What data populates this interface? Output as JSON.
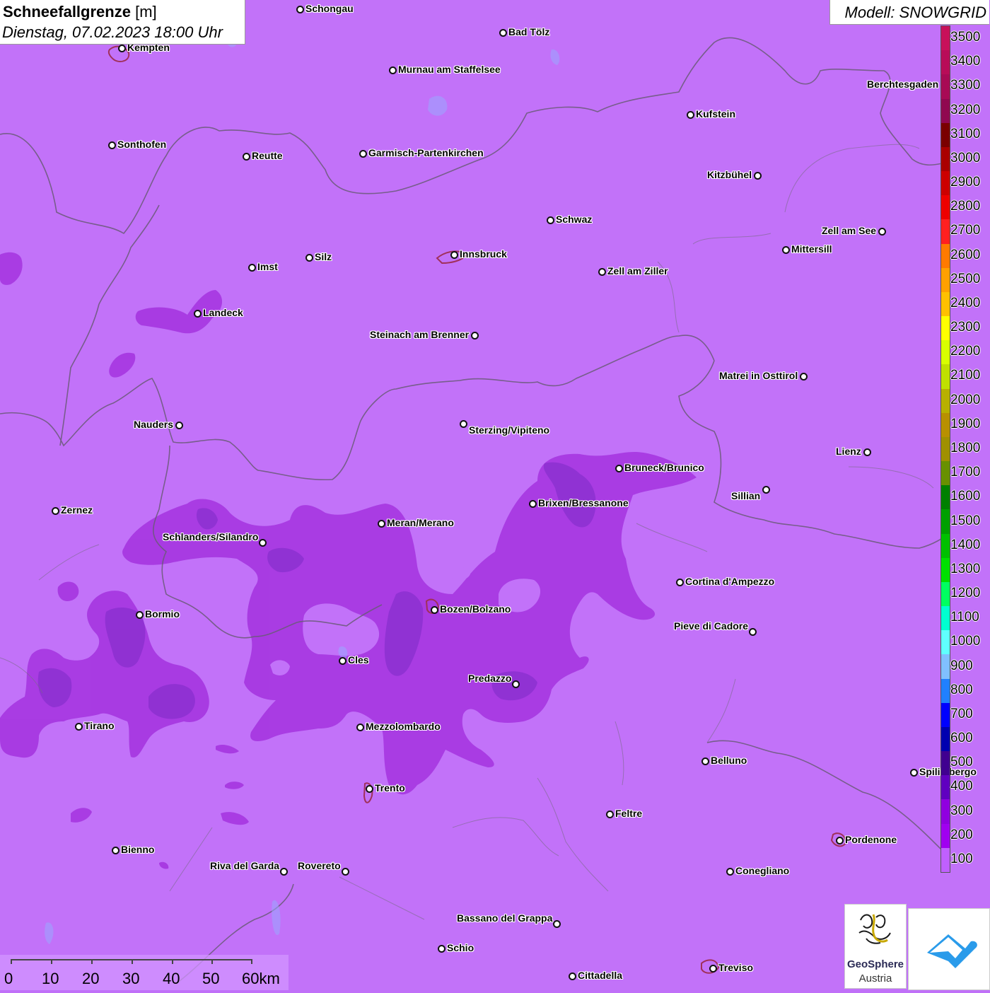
{
  "title": {
    "main": "Schneefallgrenze",
    "unit": "[m]",
    "datetime": "Dienstag, 07.02.2023 18:00 Uhr"
  },
  "model": "Modell: SNOWGRID",
  "legend": {
    "labels": [
      "3500",
      "3400",
      "3300",
      "3200",
      "3100",
      "3000",
      "2900",
      "2800",
      "2700",
      "2600",
      "2500",
      "2400",
      "2300",
      "2200",
      "2100",
      "2000",
      "1900",
      "1800",
      "1700",
      "1600",
      "1500",
      "1400",
      "1300",
      "1200",
      "1100",
      "1000",
      "900",
      "800",
      "700",
      "600",
      "500",
      "400",
      "300",
      "200",
      "100"
    ],
    "colors": [
      "#c8105a",
      "#b80c58",
      "#a80a55",
      "#900850",
      "#7a0000",
      "#aa0000",
      "#cc0000",
      "#ee0000",
      "#ff2020",
      "#ff7a00",
      "#ffa000",
      "#ffc000",
      "#ffff00",
      "#d8ff00",
      "#c0e000",
      "#b8b000",
      "#b89000",
      "#a09000",
      "#689000",
      "#008000",
      "#00a000",
      "#00c000",
      "#00e000",
      "#00ff60",
      "#00ffd0",
      "#60ffff",
      "#80c0ff",
      "#2080ff",
      "#0000ff",
      "#0000b0",
      "#400090",
      "#6000c0",
      "#9000e0",
      "#a000f0",
      "#c060ff"
    ]
  },
  "cities": [
    {
      "name": "Schongau"
    },
    {
      "name": "Bad Tölz"
    },
    {
      "name": "Kempten"
    },
    {
      "name": "Murnau am Staffelsee"
    },
    {
      "name": "Berchtesgaden"
    },
    {
      "name": "Kufstein"
    },
    {
      "name": "Sonthofen"
    },
    {
      "name": "Reutte"
    },
    {
      "name": "Garmisch-Partenkirchen"
    },
    {
      "name": "Kitzbühel"
    },
    {
      "name": "Schwaz"
    },
    {
      "name": "Zell am See"
    },
    {
      "name": "Innsbruck"
    },
    {
      "name": "Mittersill"
    },
    {
      "name": "Imst"
    },
    {
      "name": "Silz"
    },
    {
      "name": "Zell am Ziller"
    },
    {
      "name": "Landeck"
    },
    {
      "name": "Steinach am Brenner"
    },
    {
      "name": "Matrei in Osttirol"
    },
    {
      "name": "Nauders"
    },
    {
      "name": "Sterzing/Vipiteno"
    },
    {
      "name": "Lienz"
    },
    {
      "name": "Bruneck/Brunico"
    },
    {
      "name": "Sillian"
    },
    {
      "name": "Zernez"
    },
    {
      "name": "Brixen/Bressanone"
    },
    {
      "name": "Meran/Merano"
    },
    {
      "name": "Schlanders/Silandro"
    },
    {
      "name": "Cortina d'Ampezzo"
    },
    {
      "name": "Bormio"
    },
    {
      "name": "Bozen/Bolzano"
    },
    {
      "name": "Pieve di Cadore"
    },
    {
      "name": "Cles"
    },
    {
      "name": "Predazzo"
    },
    {
      "name": "Tirano"
    },
    {
      "name": "Mezzolombardo"
    },
    {
      "name": "Belluno"
    },
    {
      "name": "Spilimbergo"
    },
    {
      "name": "Trento"
    },
    {
      "name": "Feltre"
    },
    {
      "name": "Pordenone"
    },
    {
      "name": "Bienno"
    },
    {
      "name": "Riva del Garda"
    },
    {
      "name": "Rovereto"
    },
    {
      "name": "Conegliano"
    },
    {
      "name": "Bassano del Grappa"
    },
    {
      "name": "Schio"
    },
    {
      "name": "Treviso"
    },
    {
      "name": "Cittadella"
    }
  ],
  "scalebar": {
    "labels": [
      "0",
      "10",
      "20",
      "30",
      "40",
      "50",
      "60km"
    ]
  },
  "logos": {
    "geosphere_line1": "GeoSphere",
    "geosphere_line2": "Austria"
  }
}
